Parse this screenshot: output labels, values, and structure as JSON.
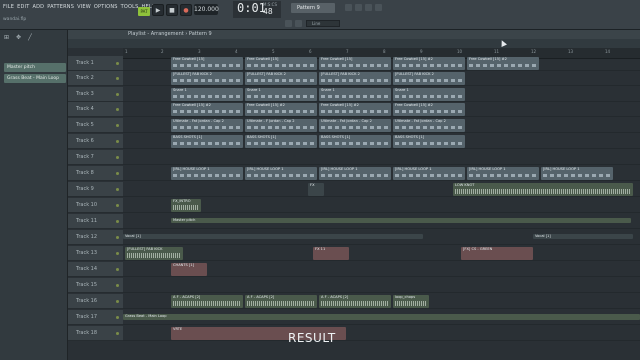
{
  "menu": [
    "FILE",
    "EDIT",
    "ADD",
    "PATTERNS",
    "VIEW",
    "OPTIONS",
    "TOOLS",
    "HELP"
  ],
  "filename": "wandai.flp",
  "transport": {
    "pat_label": "PAT",
    "play": "▶",
    "stop": "■",
    "rec": "●",
    "tempo": "120.000",
    "time_big": "0:01",
    "time_small": "M:S:CS",
    "time_ms": "48",
    "pattern": "Pattern 9",
    "snap": "Line"
  },
  "left_panel": {
    "tools": [
      "⊞",
      "✥",
      "╱"
    ],
    "items": [
      "Master pitch",
      "Grass Beat - Main Loop"
    ]
  },
  "playlist": {
    "title": "Playlist - Arrangement › Pattern 9",
    "ruler": [
      "1",
      "2",
      "3",
      "4",
      "5",
      "6",
      "7",
      "8",
      "9",
      "10",
      "11",
      "12",
      "13",
      "14",
      "15"
    ],
    "tracks": [
      "Track 1",
      "Track 2",
      "Track 3",
      "Track 4",
      "Track 5",
      "Track 6",
      "Track 7",
      "Track 8",
      "Track 9",
      "Track 10",
      "Track 11",
      "Track 12",
      "Track 13",
      "Track 14",
      "Track 15",
      "Track 16",
      "Track 17",
      "Track 18"
    ],
    "clips": {
      "t1": [
        "Free Cowbell [15]",
        "Free Cowbell [15]",
        "Free Cowbell [15]",
        "Free Cowbell [15] #2",
        "Free Cowbell [15] #2"
      ],
      "t2": [
        "[FULLEST] FAB KICK 2",
        "[FULLEST] FAB KICK 2",
        "[FULLEST] FAB KICK 2",
        "[FULLEST] FAB KICK 2"
      ],
      "t3": [
        "Snare 1",
        "Snare 1",
        "Snare 1",
        "Snare 1"
      ],
      "t4": [
        "Free Cowbell [15] #2",
        "Free Cowbell [15] #2",
        "Free Cowbell [15] #2",
        "Free Cowbell [15] #2"
      ],
      "t5": [
        "Ultimate - Fat Jordan - Cap 2",
        "Ultimate - F Jordan - Cap 2",
        "Ultimate - Fat Jordan - Cap 2",
        "Ultimate - Fat Jordan - Cap 2"
      ],
      "t6": [
        "BASS SHOTS [1]",
        "BASS SHOTS [1]",
        "BASS SHOTS [1]",
        "BASS SHOTS [1]"
      ],
      "t8": [
        "[IRL] HOUSE LOOP 1",
        "[IRL] HOUSE LOOP 1",
        "[IRL] HOUSE LOOP 1",
        "[IRL] HOUSE LOOP 1",
        "[IRL] HOUSE LOOP 1",
        "[IRL] HOUSE LOOP 1"
      ],
      "t9": [
        "FX",
        "LOW KNOT"
      ],
      "t10": [
        "FX_INTRO"
      ],
      "t11": [
        "Master pitch"
      ],
      "t12": [
        "Vocal [1]",
        "Vocal [1]"
      ],
      "t13": [
        "[FULLEST] FAB KICK",
        "FX 11",
        "[FX] CS - GREEN"
      ],
      "t14": [
        "CHANTS [1]"
      ],
      "t16": [
        "A F - ACAPS [2]",
        "A F - ACAPS [2]",
        "A F - ACAPS [2]",
        "loop_chops"
      ],
      "t17": [
        "Grass Beat - Main Loop"
      ],
      "t18": [
        "VRTE"
      ]
    }
  },
  "caption": "RESULT"
}
